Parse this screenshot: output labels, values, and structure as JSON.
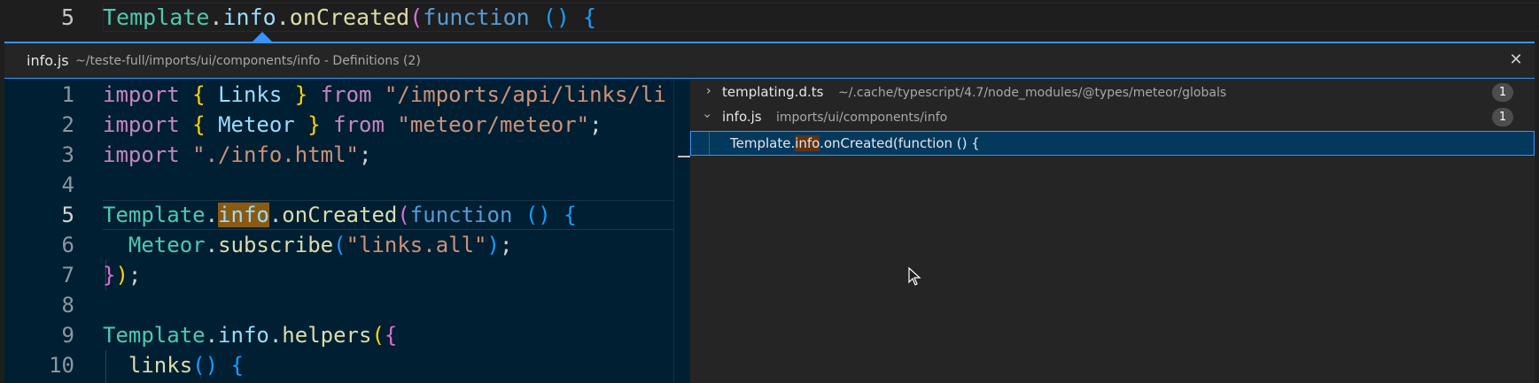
{
  "top_editor": {
    "line_number": "5",
    "tokens": [
      "Template",
      ".",
      "info",
      ".",
      "onCreated",
      "(",
      "function",
      " ",
      "(",
      ")",
      " ",
      "{"
    ]
  },
  "peek": {
    "file_name": "info.js",
    "file_path": "~/teste-full/imports/ui/components/info - Definitions (2)",
    "close_icon": "close-icon",
    "editor_lines": [
      {
        "num": "1",
        "t": [
          "import",
          " ",
          "{",
          " ",
          "Links",
          " ",
          "}",
          " ",
          "from",
          " ",
          "\"/imports/api/links/li"
        ]
      },
      {
        "num": "2",
        "t": [
          "import",
          " ",
          "{",
          " ",
          "Meteor",
          " ",
          "}",
          " ",
          "from",
          " ",
          "\"meteor/meteor\"",
          ";"
        ]
      },
      {
        "num": "3",
        "t": [
          "import",
          " ",
          "\"./info.html\"",
          ";"
        ]
      },
      {
        "num": "4",
        "t": []
      },
      {
        "num": "5",
        "t": [
          "Template",
          ".",
          "info",
          ".",
          "onCreated",
          "(",
          "function",
          " ",
          "(",
          ")",
          " ",
          "{"
        ]
      },
      {
        "num": "6",
        "t": [
          "  ",
          "Meteor",
          ".",
          "subscribe",
          "(",
          "\"links.all\"",
          ")",
          ";"
        ]
      },
      {
        "num": "7",
        "t": [
          "}",
          ")",
          ";"
        ]
      },
      {
        "num": "8",
        "t": []
      },
      {
        "num": "9",
        "t": [
          "Template",
          ".",
          "info",
          ".",
          "helpers",
          "(",
          "{"
        ]
      },
      {
        "num": "10",
        "t": [
          "  ",
          "links",
          "(",
          ")",
          " ",
          "{"
        ]
      }
    ],
    "tree": {
      "items": [
        {
          "name": "templating.d.ts",
          "path": "~/.cache/typescript/4.7/node_modules/@types/meteor/globals",
          "count": "1",
          "expanded": false
        },
        {
          "name": "info.js",
          "path": "imports/ui/components/info",
          "count": "1",
          "expanded": true
        }
      ],
      "selected_match": {
        "before": "Template.",
        "match": "info",
        "after": ".onCreated(function () {"
      }
    }
  }
}
